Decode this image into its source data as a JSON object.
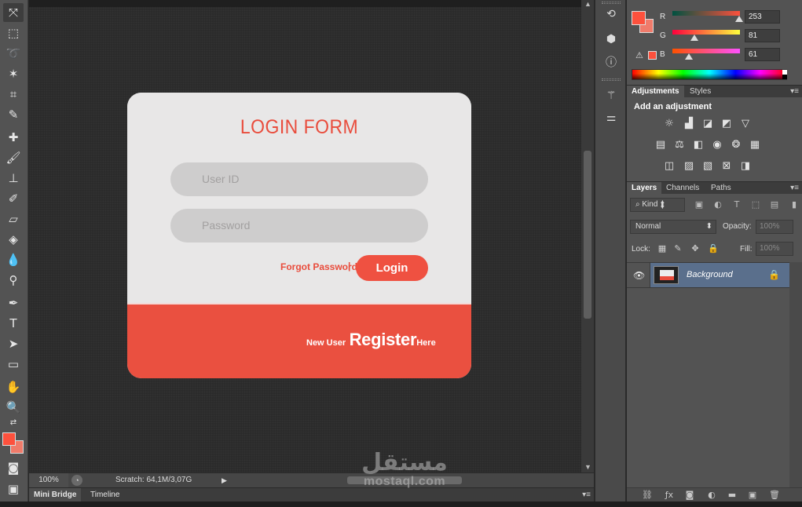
{
  "card": {
    "title": "LOGIN FORM",
    "user_placeholder": "User ID",
    "password_placeholder": "Password",
    "forgot": "Forgot Password",
    "separator": "|",
    "login": "Login",
    "new_user": "New User",
    "register": "Register",
    "here": "Here",
    "colors": {
      "accent": "#e94c3c",
      "panel": "#e8e7e7",
      "field": "#cecdcd"
    }
  },
  "status": {
    "zoom": "100%",
    "scratch": "Scratch: 64,1M/3,07G"
  },
  "bottom_tabs": [
    "Mini Bridge",
    "Timeline"
  ],
  "color_panel": {
    "r_label": "R",
    "g_label": "G",
    "b_label": "B",
    "r": "253",
    "g": "81",
    "b": "61",
    "r_level": 0.99,
    "g_level": 0.32,
    "b_level": 0.24,
    "foreground": "#fd513d"
  },
  "adjustments": {
    "tabs": [
      "Adjustments",
      "Styles"
    ],
    "heading": "Add an adjustment"
  },
  "layers": {
    "tabs": [
      "Layers",
      "Channels",
      "Paths"
    ],
    "kind": "Kind",
    "blend": "Normal",
    "opacity_label": "Opacity:",
    "opacity": "100%",
    "lock_label": "Lock:",
    "fill_label": "Fill:",
    "fill": "100%",
    "layer_name": "Background"
  },
  "watermark": {
    "arabic": "مستقل",
    "latin": "mostaql.com"
  }
}
